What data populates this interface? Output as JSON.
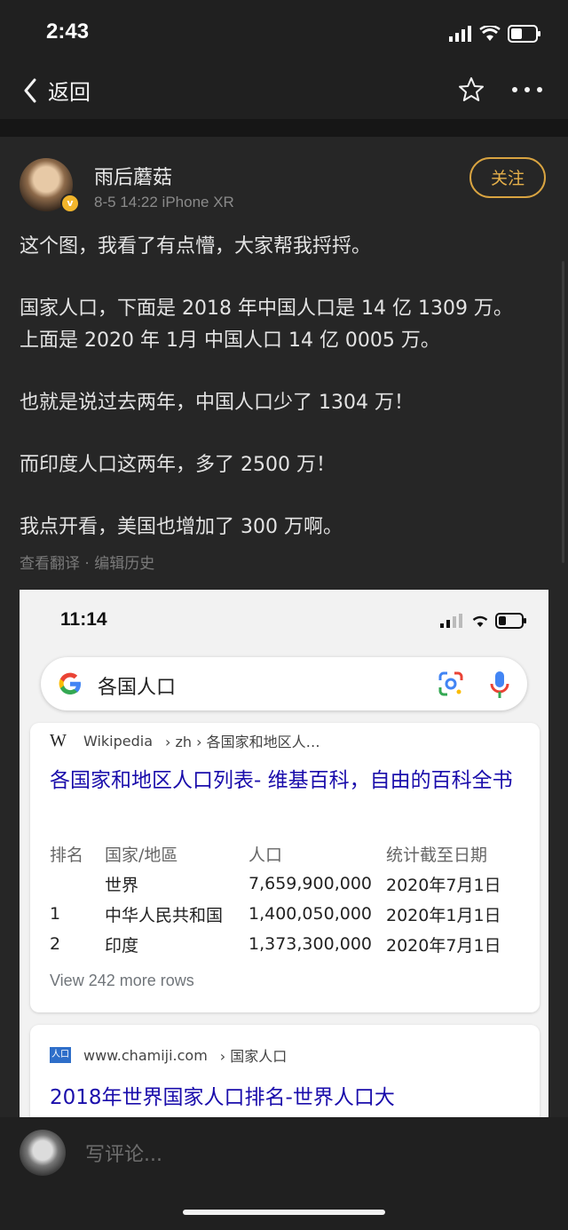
{
  "status_bar": {
    "time": "2:43"
  },
  "nav": {
    "back_label": "返回",
    "icons": [
      "chevron-left-icon",
      "star-icon",
      "more-icon"
    ]
  },
  "post": {
    "author": "雨后蘑菇",
    "verified_badge": "v",
    "meta": "8-5 14:22   iPhone XR",
    "follow_label": "关注",
    "paragraphs": [
      "这个图，我看了有点懵，大家帮我捋捋。",
      "国家人口，下面是 2018 年中国人口是 14 亿 1309 万。",
      "上面是 2020 年 1月 中国人口 14 亿 0005 万。",
      "也就是说过去两年，中国人口少了 1304 万！",
      "而印度人口这两年，多了 2500 万！",
      "我点开看，美国也增加了 300 万啊。"
    ],
    "sub_links": "查看翻译 · 编辑历史"
  },
  "screenshot": {
    "time": "11:14",
    "search_query": "各国人口",
    "result1": {
      "source_site": "Wikipedia",
      "source_path": "› zh › 各国家和地区人…",
      "title": "各国家和地区人口列表- 维基百科，自由的百科全书",
      "table_headers": [
        "排名",
        "国家/地區",
        "人口",
        "统计截至日期"
      ],
      "rows": [
        [
          "",
          "世界",
          "7,659,900,000",
          "2020年7月1日"
        ],
        [
          "1",
          "中华人民共和国",
          "1,400,050,000",
          "2020年1月1日"
        ],
        [
          "2",
          "印度",
          "1,373,300,000",
          "2020年7月1日"
        ]
      ],
      "more_rows": "View 242 more rows"
    },
    "result2": {
      "source_icon_text": "人口",
      "source_site": "www.chamiji.com",
      "source_path": "› 国家人口",
      "title": "2018年世界国家人口排名-世界人口大"
    }
  },
  "comment_bar": {
    "placeholder": "写评论..."
  },
  "colors": {
    "background": "#202020",
    "post_background": "#262626",
    "accent_follow": "#e6b04a",
    "link_blue": "#1a0dab"
  }
}
